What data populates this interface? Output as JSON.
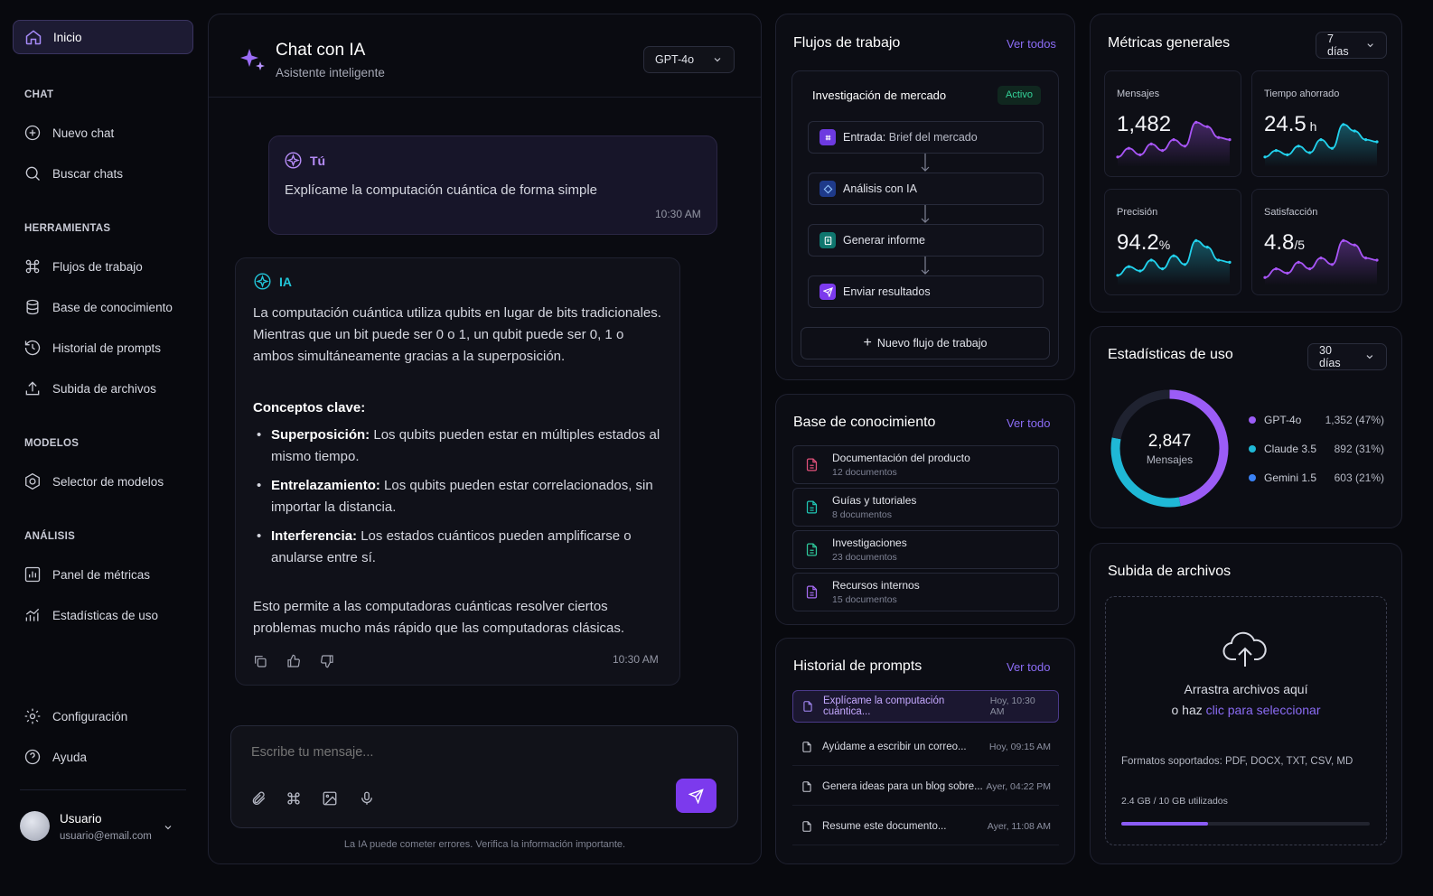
{
  "sidebar": {
    "home": "Inicio",
    "sections": {
      "chat": "CHAT",
      "tools": "HERRAMIENTAS",
      "models": "MODELOS",
      "analysis": "ANÁLISIS"
    },
    "items": {
      "new_chat": "Nuevo chat",
      "search": "Buscar chats",
      "workflows": "Flujos de trabajo",
      "kb": "Base de conocimiento",
      "history": "Historial de prompts",
      "upload": "Subida de archivos",
      "model_selector": "Selector de modelos",
      "metrics": "Panel de métricas",
      "stats": "Estadísticas de uso",
      "settings": "Configuración",
      "help": "Ayuda"
    },
    "user": {
      "name": "Usuario",
      "email": "usuario@email.com"
    }
  },
  "chat": {
    "title": "Chat con IA",
    "subtitle": "Asistente inteligente",
    "model": "GPT-4o",
    "user_msg": {
      "author": "Tú",
      "text": "Explícame la computación cuántica de forma simple",
      "time": "10:30 AM"
    },
    "ai_msg": {
      "author": "IA",
      "intro": "La computación cuántica utiliza qubits en lugar de bits tradicionales. Mientras que un bit puede ser 0 o 1, un qubit puede ser 0, 1 o ambos simultáneamente gracias a la superposición.",
      "concepts_title": "Conceptos clave:",
      "c1_term": "Superposición:",
      "c1_text": " Los qubits pueden estar en múltiples estados al mismo tiempo.",
      "c2_term": "Entrelazamiento:",
      "c2_text": " Los qubits pueden estar correlacionados, sin importar la distancia.",
      "c3_term": "Interferencia:",
      "c3_text": " Los estados cuánticos pueden amplificarse o anularse entre sí.",
      "outro": "Esto permite a las computadoras cuánticas resolver ciertos problemas mucho más rápido que las computadoras clásicas.",
      "time": "10:30 AM"
    },
    "input_placeholder": "Escribe tu mensaje...",
    "disclaimer": "La IA puede cometer errores. Verifica la información importante."
  },
  "workflows": {
    "title": "Flujos de trabajo",
    "link": "Ver todos",
    "flow_name": "Investigación de mercado",
    "status": "Activo",
    "step1_a": "Entrada:",
    "step1_b": " Brief del mercado",
    "step2": "Análisis con IA",
    "step3": "Generar informe",
    "step4": "Enviar resultados",
    "new": "Nuevo flujo de trabajo"
  },
  "kb": {
    "title": "Base de conocimiento",
    "link": "Ver todo",
    "items": [
      {
        "name": "Documentación del producto",
        "count": "12 documentos",
        "color": "#e0507a"
      },
      {
        "name": "Guías y tutoriales",
        "count": "8 documentos",
        "color": "#1fc6b4"
      },
      {
        "name": "Investigaciones",
        "count": "23 documentos",
        "color": "#2ec79a"
      },
      {
        "name": "Recursos internos",
        "count": "15 documentos",
        "color": "#a46af0"
      }
    ]
  },
  "prompts": {
    "title": "Historial de prompts",
    "link": "Ver todo",
    "items": [
      {
        "text": "Explícame la computación cuántica...",
        "date": "Hoy, 10:30 AM"
      },
      {
        "text": "Ayúdame a escribir un correo...",
        "date": "Hoy, 09:15 AM"
      },
      {
        "text": "Genera ideas para un blog sobre...",
        "date": "Ayer, 04:22 PM"
      },
      {
        "text": "Resume este documento...",
        "date": "Ayer, 11:08 AM"
      }
    ]
  },
  "metrics": {
    "title": "Métricas generales",
    "range": "7 días",
    "cards": [
      {
        "label": "Mensajes",
        "value": "1,482",
        "unit": "",
        "color": "#a855f7"
      },
      {
        "label": "Tiempo ahorrado",
        "value": "24.5",
        "unit": " h",
        "color": "#22d3ee"
      },
      {
        "label": "Precisión",
        "value": "94.2",
        "unit": "%",
        "color": "#22d3ee"
      },
      {
        "label": "Satisfacción",
        "value": "4.8",
        "unit": "/5",
        "color": "#a855f7"
      }
    ]
  },
  "usage": {
    "title": "Estadísticas de uso",
    "range": "30 días",
    "total": "2,847",
    "total_label": "Mensajes",
    "series": [
      {
        "name": "GPT-4o",
        "value": "1,352 (47%)",
        "fraction": 0.47,
        "color": "#9b5cf6"
      },
      {
        "name": "Claude 3.5",
        "value": "892 (31%)",
        "fraction": 0.31,
        "color": "#1fb8d6"
      },
      {
        "name": "Gemini 1.5",
        "value": "603 (21%)",
        "fraction": 0.21,
        "color": "#3b82f6"
      }
    ]
  },
  "upload": {
    "title": "Subida de archivos",
    "drag": "Arrastra archivos aquí",
    "or": "o haz ",
    "click": "clic para seleccionar",
    "formats": "Formatos soportados: PDF, DOCX, TXT, CSV, MD",
    "usage": "2.4 GB / 10 GB utilizados",
    "usage_fraction": 0.24
  }
}
